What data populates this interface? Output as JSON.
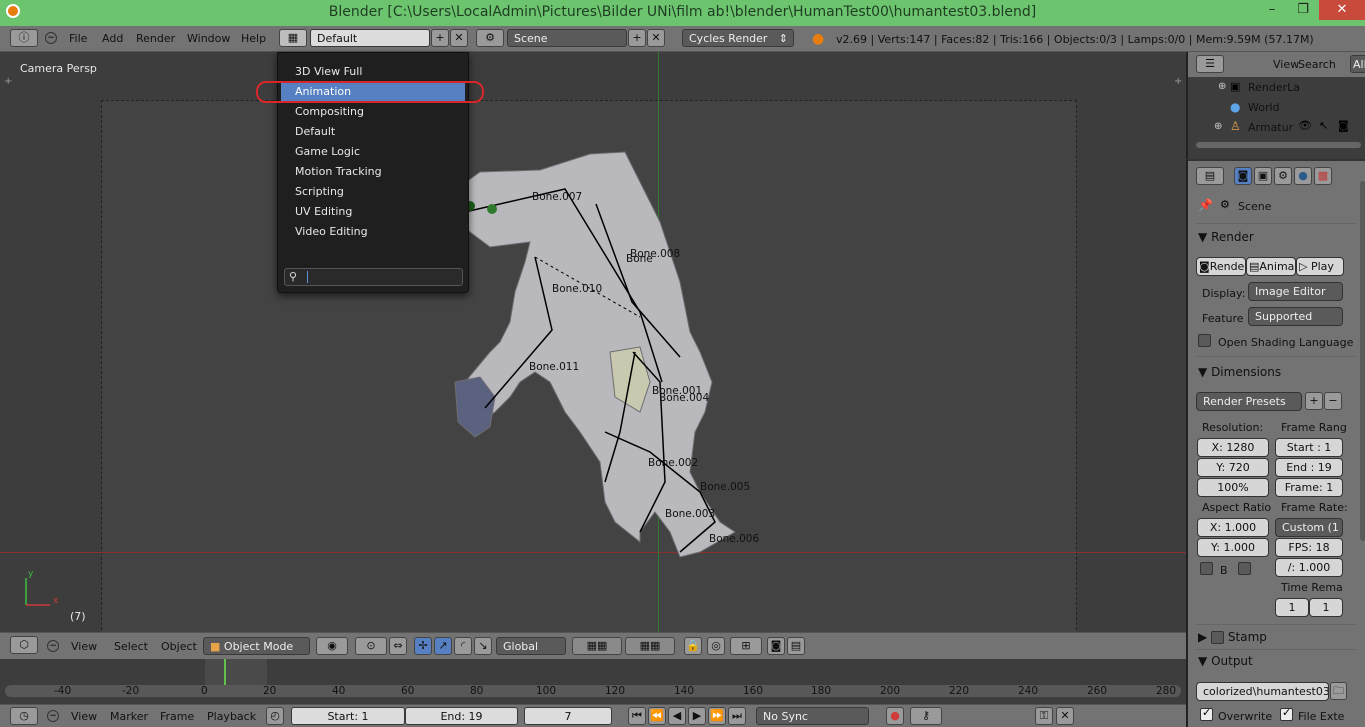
{
  "window": {
    "title": "Blender [C:\\Users\\LocalAdmin\\Pictures\\Bilder UNi\\film ab!\\blender\\HumanTest00\\humantest03.blend]",
    "min": "–",
    "max": "❐",
    "close": "✕"
  },
  "info_header": {
    "menus": [
      "File",
      "Add",
      "Render",
      "Window",
      "Help"
    ],
    "screen_layout": "Default",
    "scene": "Scene",
    "render_engine": "Cycles Render",
    "stats": "v2.69 | Verts:147 | Faces:82 | Tris:166 | Objects:0/3 | Lamps:0/0 | Mem:9.59M (57.17M)"
  },
  "layout_menu": {
    "items": [
      "3D View Full",
      "Animation",
      "Compositing",
      "Default",
      "Game Logic",
      "Motion Tracking",
      "Scripting",
      "UV Editing",
      "Video Editing"
    ],
    "selected": "Animation",
    "highlight_color": "#5680c2",
    "annotation_color": "#d8262a"
  },
  "viewport": {
    "label": "Camera Persp",
    "frame_indicator": "(7)",
    "axis_y": "y",
    "axis_x": "x",
    "bones": [
      "Bone.007",
      "Bone.008",
      "Bone",
      "Bone.010",
      "Bone.011",
      "Bone.001",
      "Bone.004",
      "Bone.002",
      "Bone.005",
      "Bone.003",
      "Bone.006"
    ]
  },
  "view3d_header": {
    "menus": [
      "View",
      "Select",
      "Object"
    ],
    "mode": "Object Mode",
    "orientation": "Global"
  },
  "timeline": {
    "ticks": [
      "-40",
      "-20",
      "0",
      "20",
      "40",
      "60",
      "80",
      "100",
      "120",
      "140",
      "160",
      "180",
      "200",
      "220",
      "240",
      "260",
      "280"
    ],
    "current_frame_color": "#62c04a"
  },
  "timeline_header": {
    "menus": [
      "View",
      "Marker",
      "Frame",
      "Playback"
    ],
    "start": "Start: 1",
    "end": "End: 19",
    "current": "7",
    "sync": "No Sync"
  },
  "outliner": {
    "menus": [
      "View",
      "Search",
      "All"
    ],
    "items": [
      "RenderLa",
      "World",
      "Armatur"
    ]
  },
  "properties": {
    "context": "Scene",
    "render": {
      "header": "Render",
      "buttons": [
        "Rende",
        "Anima",
        "Play"
      ],
      "display_label": "Display:",
      "display_value": "Image Editor",
      "feature_label": "Feature",
      "feature_value": "Supported",
      "osl_label": "Open Shading Language"
    },
    "dimensions": {
      "header": "Dimensions",
      "presets": "Render Presets",
      "resolution_label": "Resolution:",
      "res_x": "X: 1280",
      "res_y": "Y: 720",
      "res_pct": "100%",
      "frame_range_label": "Frame Rang",
      "start": "Start : 1",
      "end": "End : 19",
      "frame": "Frame: 1",
      "aspect_label": "Aspect Ratio",
      "aspect_x": "X: 1.000",
      "aspect_y": "Y: 1.000",
      "border_label": "B",
      "framerate_label": "Frame Rate:",
      "framerate_preset": "Custom (1",
      "fps": "FPS: 18",
      "fps_base": "/: 1.000",
      "time_remap_label": "Time Rema",
      "remap_old": "1",
      "remap_new": "1"
    },
    "stamp": {
      "header": "Stamp"
    },
    "output": {
      "header": "Output",
      "path": "colorized\\humantest03",
      "overwrite": "Overwrite",
      "file_ext": "File Exte"
    }
  }
}
